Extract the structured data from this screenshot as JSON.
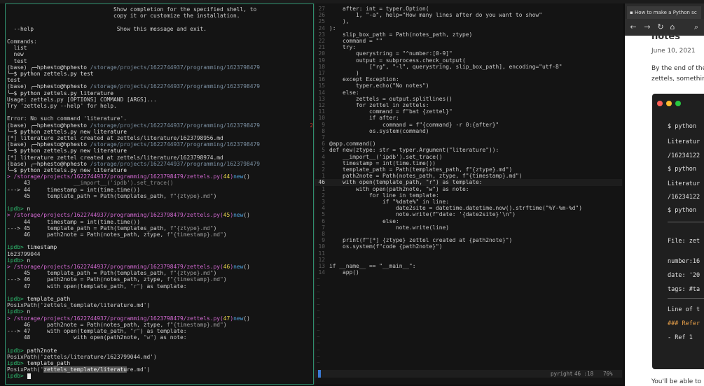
{
  "terminal": {
    "lines": [
      [
        {
          "t": "                                Show completion for the specified shell, to",
          "c": "#cfcfcf"
        }
      ],
      [
        {
          "t": "                                copy it or customize the installation.",
          "c": "#cfcfcf"
        }
      ],
      [
        {
          "t": "",
          "c": "#cfcfcf"
        }
      ],
      [
        {
          "t": "  --help                         Show this message and exit.",
          "c": "#cfcfcf"
        }
      ],
      [
        {
          "t": "",
          "c": "#cfcfcf"
        }
      ],
      [
        {
          "t": "Commands:",
          "c": "#cfcfcf"
        }
      ],
      [
        {
          "t": "  list",
          "c": "#cfcfcf"
        }
      ],
      [
        {
          "t": "  new",
          "c": "#cfcfcf"
        }
      ],
      [
        {
          "t": "  test",
          "c": "#cfcfcf"
        }
      ],
      [
        {
          "t": "(base) ",
          "c": "#cfcfcf"
        },
        {
          "t": "╭─hphesto@hphesto ",
          "c": "#e0e0e0"
        },
        {
          "t": "/storage/projects/1622744937/programming/1623798479",
          "c": "#7a8ea0"
        }
      ],
      [
        {
          "t": "╰─$ python zettels.py test",
          "c": "#e0e0e0"
        }
      ],
      [
        {
          "t": "test",
          "c": "#cfcfcf"
        }
      ],
      [
        {
          "t": "(base) ",
          "c": "#cfcfcf"
        },
        {
          "t": "╭─hphesto@hphesto ",
          "c": "#e0e0e0"
        },
        {
          "t": "/storage/projects/1622744937/programming/1623798479",
          "c": "#7a8ea0"
        }
      ],
      [
        {
          "t": "╰─$ python zettels.py literature",
          "c": "#e0e0e0"
        }
      ],
      [
        {
          "t": "Usage: zettels.py [OPTIONS] COMMAND [ARGS]...",
          "c": "#cfcfcf"
        }
      ],
      [
        {
          "t": "Try 'zettels.py --help' for help.",
          "c": "#cfcfcf"
        }
      ],
      [
        {
          "t": "",
          "c": "#cfcfcf"
        }
      ],
      [
        {
          "t": "Error: No such command 'literature'.",
          "c": "#cfcfcf"
        }
      ],
      [
        {
          "t": "(base) ",
          "c": "#cfcfcf"
        },
        {
          "t": "╭─hphesto@hphesto ",
          "c": "#e0e0e0"
        },
        {
          "t": "/storage/projects/1622744937/programming/1623798479",
          "c": "#7a8ea0"
        },
        {
          "t": "               2 ↵",
          "c": "#c0392b"
        }
      ],
      [
        {
          "t": "╰─$ python zettels.py new literature",
          "c": "#e0e0e0"
        }
      ],
      [
        {
          "t": "[*] literature zettel created at zettels/literature/1623798956.md",
          "c": "#cfcfcf"
        }
      ],
      [
        {
          "t": "(base) ",
          "c": "#cfcfcf"
        },
        {
          "t": "╭─hphesto@hphesto ",
          "c": "#e0e0e0"
        },
        {
          "t": "/storage/projects/1622744937/programming/1623798479",
          "c": "#7a8ea0"
        }
      ],
      [
        {
          "t": "╰─$ python zettels.py new literature",
          "c": "#e0e0e0"
        }
      ],
      [
        {
          "t": "[*] literature zettel created at zettels/literature/1623798974.md",
          "c": "#cfcfcf"
        }
      ],
      [
        {
          "t": "(base) ",
          "c": "#cfcfcf"
        },
        {
          "t": "╭─hphesto@hphesto ",
          "c": "#e0e0e0"
        },
        {
          "t": "/storage/projects/1622744937/programming/1623798479",
          "c": "#7a8ea0"
        }
      ],
      [
        {
          "t": "╰─$ python zettels.py new literature",
          "c": "#e0e0e0"
        }
      ],
      [
        {
          "t": "> /storage/projects/1622744937/programming/1623798479/zettels.py(",
          "c": "#d46ad4"
        },
        {
          "t": "44",
          "c": "#e8d44d"
        },
        {
          "t": ")",
          "c": "#d46ad4"
        },
        {
          "t": "new",
          "c": "#4fa3e0"
        },
        {
          "t": "()",
          "c": "#cfcfcf"
        }
      ],
      [
        {
          "t": "     43             ",
          "c": "#cfcfcf"
        },
        {
          "t": "__import__('ipdb').set_trace()",
          "c": "#8a8a8a"
        }
      ],
      [
        {
          "t": "---> 44     ",
          "c": "#cfcfcf"
        },
        {
          "t": "timestamp = int(time.time())",
          "c": "#cfcfcf"
        }
      ],
      [
        {
          "t": "     45     ",
          "c": "#cfcfcf"
        },
        {
          "t": "template_path = Path(templates_path, ",
          "c": "#cfcfcf"
        },
        {
          "t": "f\"{ztype}.md\"",
          "c": "#9a9a9a"
        },
        {
          "t": ")",
          "c": "#cfcfcf"
        }
      ],
      [
        {
          "t": "",
          "c": "#cfcfcf"
        }
      ],
      [
        {
          "t": "ipdb> ",
          "c": "#2fbf71"
        },
        {
          "t": "n",
          "c": "#e0e0e0"
        }
      ],
      [
        {
          "t": "> /storage/projects/1622744937/programming/1623798479/zettels.py(",
          "c": "#d46ad4"
        },
        {
          "t": "45",
          "c": "#e8d44d"
        },
        {
          "t": ")",
          "c": "#d46ad4"
        },
        {
          "t": "new",
          "c": "#4fa3e0"
        },
        {
          "t": "()",
          "c": "#cfcfcf"
        }
      ],
      [
        {
          "t": "     44     ",
          "c": "#cfcfcf"
        },
        {
          "t": "timestamp = int(time.time())",
          "c": "#cfcfcf"
        }
      ],
      [
        {
          "t": "---> 45     ",
          "c": "#cfcfcf"
        },
        {
          "t": "template_path = Path(templates_path, ",
          "c": "#cfcfcf"
        },
        {
          "t": "f\"{ztype}.md\"",
          "c": "#9a9a9a"
        },
        {
          "t": ")",
          "c": "#cfcfcf"
        }
      ],
      [
        {
          "t": "     46     ",
          "c": "#cfcfcf"
        },
        {
          "t": "path2note = Path(notes_path, ztype, ",
          "c": "#cfcfcf"
        },
        {
          "t": "f\"{timestamp}.md\"",
          "c": "#9a9a9a"
        },
        {
          "t": ")",
          "c": "#cfcfcf"
        }
      ],
      [
        {
          "t": "",
          "c": "#cfcfcf"
        }
      ],
      [
        {
          "t": "ipdb> ",
          "c": "#2fbf71"
        },
        {
          "t": "timestamp",
          "c": "#e0e0e0"
        }
      ],
      [
        {
          "t": "1623799044",
          "c": "#cfcfcf"
        }
      ],
      [
        {
          "t": "ipdb> ",
          "c": "#2fbf71"
        },
        {
          "t": "n",
          "c": "#e0e0e0"
        }
      ],
      [
        {
          "t": "> /storage/projects/1622744937/programming/1623798479/zettels.py(",
          "c": "#d46ad4"
        },
        {
          "t": "46",
          "c": "#e8d44d"
        },
        {
          "t": ")",
          "c": "#d46ad4"
        },
        {
          "t": "new",
          "c": "#4fa3e0"
        },
        {
          "t": "()",
          "c": "#cfcfcf"
        }
      ],
      [
        {
          "t": "     45     ",
          "c": "#cfcfcf"
        },
        {
          "t": "template_path = Path(templates_path, ",
          "c": "#cfcfcf"
        },
        {
          "t": "f\"{ztype}.md\"",
          "c": "#9a9a9a"
        },
        {
          "t": ")",
          "c": "#cfcfcf"
        }
      ],
      [
        {
          "t": "---> 46     ",
          "c": "#cfcfcf"
        },
        {
          "t": "path2note = Path(notes_path, ztype, ",
          "c": "#cfcfcf"
        },
        {
          "t": "f\"{timestamp}.md\"",
          "c": "#9a9a9a"
        },
        {
          "t": ")",
          "c": "#cfcfcf"
        }
      ],
      [
        {
          "t": "     47     ",
          "c": "#cfcfcf"
        },
        {
          "t": "with open(template_path, ",
          "c": "#cfcfcf"
        },
        {
          "t": "\"r\"",
          "c": "#9a9a9a"
        },
        {
          "t": ") as template:",
          "c": "#cfcfcf"
        }
      ],
      [
        {
          "t": "",
          "c": "#cfcfcf"
        }
      ],
      [
        {
          "t": "ipdb> ",
          "c": "#2fbf71"
        },
        {
          "t": "template_path",
          "c": "#e0e0e0"
        }
      ],
      [
        {
          "t": "PosixPath('zettels_template/literature.md')",
          "c": "#cfcfcf"
        }
      ],
      [
        {
          "t": "ipdb> ",
          "c": "#2fbf71"
        },
        {
          "t": "n",
          "c": "#e0e0e0"
        }
      ],
      [
        {
          "t": "> /storage/projects/1622744937/programming/1623798479/zettels.py(",
          "c": "#d46ad4"
        },
        {
          "t": "47",
          "c": "#e8d44d"
        },
        {
          "t": ")",
          "c": "#d46ad4"
        },
        {
          "t": "new",
          "c": "#4fa3e0"
        },
        {
          "t": "()",
          "c": "#cfcfcf"
        }
      ],
      [
        {
          "t": "     46     ",
          "c": "#cfcfcf"
        },
        {
          "t": "path2note = Path(notes_path, ztype, ",
          "c": "#cfcfcf"
        },
        {
          "t": "f\"{timestamp}.md\"",
          "c": "#9a9a9a"
        },
        {
          "t": ")",
          "c": "#cfcfcf"
        }
      ],
      [
        {
          "t": "---> 47     ",
          "c": "#cfcfcf"
        },
        {
          "t": "with open(template_path, ",
          "c": "#cfcfcf"
        },
        {
          "t": "\"r\"",
          "c": "#9a9a9a"
        },
        {
          "t": ") as template:",
          "c": "#cfcfcf"
        }
      ],
      [
        {
          "t": "     48             ",
          "c": "#cfcfcf"
        },
        {
          "t": "with open(path2note, ",
          "c": "#cfcfcf"
        },
        {
          "t": "\"w\"",
          "c": "#9a9a9a"
        },
        {
          "t": ") as note:",
          "c": "#cfcfcf"
        }
      ],
      [
        {
          "t": "",
          "c": "#cfcfcf"
        }
      ],
      [
        {
          "t": "ipdb> ",
          "c": "#2fbf71"
        },
        {
          "t": "path2note",
          "c": "#e0e0e0"
        }
      ],
      [
        {
          "t": "PosixPath('zettels/literature/1623799044.md')",
          "c": "#cfcfcf"
        }
      ],
      [
        {
          "t": "ipdb> ",
          "c": "#2fbf71"
        },
        {
          "t": "template_path",
          "c": "#e0e0e0"
        }
      ],
      [
        {
          "t": "PosixPath('",
          "c": "#cfcfcf"
        },
        {
          "t": "zettels_template/literatu",
          "c": "#eeeeee",
          "sel": true
        },
        {
          "t": "re.md')",
          "c": "#cfcfcf"
        }
      ],
      [
        {
          "t": "ipdb> ",
          "c": "#2fbf71"
        },
        {
          "t": "",
          "c": "#e0e0e0",
          "cursor": true
        }
      ]
    ]
  },
  "editor": {
    "lines": [
      {
        "n": "27",
        "parts": [
          {
            "t": "    after: int = typer.Option(",
            "c": "#c9c9c9"
          }
        ]
      },
      {
        "n": "26",
        "parts": [
          {
            "t": "        1, \"-a\", help=\"How many lines after do you want to show\"",
            "c": "#c9c9c9"
          }
        ]
      },
      {
        "n": "25",
        "parts": [
          {
            "t": "    ),",
            "c": "#c9c9c9"
          }
        ]
      },
      {
        "n": "24",
        "parts": [
          {
            "t": "):",
            "c": "#c9c9c9"
          }
        ]
      },
      {
        "n": "23",
        "parts": [
          {
            "t": "    slip_box_path = Path(notes_path, ztype)",
            "c": "#c9c9c9"
          }
        ]
      },
      {
        "n": "22",
        "parts": [
          {
            "t": "    command = \"\"",
            "c": "#c9c9c9"
          }
        ]
      },
      {
        "n": "21",
        "parts": [
          {
            "t": "    try:",
            "c": "#c9c9c9"
          }
        ]
      },
      {
        "n": "20",
        "parts": [
          {
            "t": "        querystring = \"^number:[0-9]\"",
            "c": "#c9c9c9"
          }
        ]
      },
      {
        "n": "19",
        "parts": [
          {
            "t": "        output = subprocess.check_output(",
            "c": "#c9c9c9"
          }
        ]
      },
      {
        "n": "18",
        "parts": [
          {
            "t": "            [\"rg\", \"-l\", querystring, slip_box_path], encoding=\"utf-8\"",
            "c": "#c9c9c9"
          }
        ]
      },
      {
        "n": "17",
        "parts": [
          {
            "t": "        )",
            "c": "#c9c9c9"
          }
        ]
      },
      {
        "n": "16",
        "parts": [
          {
            "t": "    except Exception:",
            "c": "#c9c9c9"
          }
        ]
      },
      {
        "n": "15",
        "parts": [
          {
            "t": "        typer.echo(\"No notes\")",
            "c": "#c9c9c9"
          }
        ]
      },
      {
        "n": "14",
        "parts": [
          {
            "t": "    else:",
            "c": "#c9c9c9"
          }
        ]
      },
      {
        "n": "13",
        "parts": [
          {
            "t": "        zettels = output.splitlines()",
            "c": "#c9c9c9"
          }
        ]
      },
      {
        "n": "12",
        "parts": [
          {
            "t": "        for zettel in zettels:",
            "c": "#c9c9c9"
          }
        ]
      },
      {
        "n": "11",
        "parts": [
          {
            "t": "            command = f\"bat {zettel}\"",
            "c": "#c9c9c9"
          }
        ]
      },
      {
        "n": "10",
        "parts": [
          {
            "t": "            if after:",
            "c": "#c9c9c9"
          }
        ]
      },
      {
        "n": "9",
        "parts": [
          {
            "t": "                command = f\"{command} -r 0:{after}\"",
            "c": "#c9c9c9"
          }
        ]
      },
      {
        "n": "8",
        "parts": [
          {
            "t": "            os.system(command)",
            "c": "#c9c9c9"
          }
        ]
      },
      {
        "n": "7",
        "parts": [
          {
            "t": "",
            "c": "#c9c9c9"
          }
        ]
      },
      {
        "n": "6",
        "parts": [
          {
            "t": "@app.command()",
            "c": "#c9c9c9"
          }
        ]
      },
      {
        "n": "5",
        "parts": [
          {
            "t": "def new(ztype: str = typer.Argument(\"literature\")):",
            "c": "#c9c9c9"
          }
        ]
      },
      {
        "n": "4",
        "parts": [
          {
            "t": "    __import__('ipdb').set_trace()",
            "c": "#c9c9c9"
          }
        ]
      },
      {
        "n": "3",
        "parts": [
          {
            "t": "    timestamp = int(time.time())",
            "c": "#c9c9c9"
          }
        ]
      },
      {
        "n": "2",
        "parts": [
          {
            "t": "    template_path = Path(templates_path, f\"{ztype}.md\")",
            "c": "#c9c9c9"
          }
        ]
      },
      {
        "n": "1",
        "parts": [
          {
            "t": "    path2note = Path(notes_path, ztype, f\"{timestamp}.md\")",
            "c": "#c9c9c9"
          }
        ]
      },
      {
        "n": "46",
        "parts": [
          {
            "t": "    with open(template_path, \"r\") as template:",
            "c": "#c9c9c9"
          }
        ]
      },
      {
        "n": "1",
        "parts": [
          {
            "t": "        with open(path2note, \"w\") as note:",
            "c": "#c9c9c9"
          }
        ]
      },
      {
        "n": "2",
        "parts": [
          {
            "t": "            for line in template:",
            "c": "#c9c9c9"
          }
        ]
      },
      {
        "n": "3",
        "parts": [
          {
            "t": "                if \"%date%\" in line:",
            "c": "#c9c9c9"
          }
        ]
      },
      {
        "n": "4",
        "parts": [
          {
            "t": "                    date2site = datetime.datetime.now().strftime(\"%Y-%m-%d\")",
            "c": "#c9c9c9"
          }
        ]
      },
      {
        "n": "5",
        "parts": [
          {
            "t": "                    note.write(f\"date: '{date2site}'\\n\")",
            "c": "#c9c9c9"
          }
        ]
      },
      {
        "n": "6",
        "parts": [
          {
            "t": "                else:",
            "c": "#c9c9c9"
          }
        ]
      },
      {
        "n": "7",
        "parts": [
          {
            "t": "                    note.write(line)",
            "c": "#c9c9c9"
          }
        ]
      },
      {
        "n": "8",
        "parts": [
          {
            "t": "",
            "c": "#c9c9c9"
          }
        ]
      },
      {
        "n": "9",
        "parts": [
          {
            "t": "    print(f\"[*] {ztype} zettel created at {path2note}\")",
            "c": "#c9c9c9"
          }
        ]
      },
      {
        "n": "10",
        "parts": [
          {
            "t": "    os.system(f\"code {path2note}\")",
            "c": "#c9c9c9"
          }
        ]
      },
      {
        "n": "11",
        "parts": [
          {
            "t": "",
            "c": "#c9c9c9"
          }
        ]
      },
      {
        "n": "12",
        "parts": [
          {
            "t": "",
            "c": "#c9c9c9"
          }
        ]
      },
      {
        "n": "13",
        "parts": [
          {
            "t": "if __name__ == \"__main__\":",
            "c": "#c9c9c9"
          }
        ]
      },
      {
        "n": "14",
        "parts": [
          {
            "t": "    app()",
            "c": "#c9c9c9"
          }
        ]
      }
    ],
    "tilde": "~",
    "tilde_count": 14,
    "status": {
      "lsp": "pyright",
      "position": "46 :18",
      "percent": "76%"
    }
  },
  "browser": {
    "tab_title": "How to make a Python sc",
    "nav": {
      "back": "←",
      "forward": "→",
      "reload": "↻",
      "home": "⌂",
      "search": "⌕"
    },
    "page": {
      "heading_partial": "notes",
      "date": "June 10, 2021",
      "intro1": "By the end of the",
      "intro2": "zettels, somethin",
      "footer": "You'll be able to",
      "code_lines": [
        "$ python",
        "Literatur",
        "/16234122",
        "$ python",
        "Literatur",
        "/16234122",
        "$ python",
        "",
        "File: zet",
        "",
        "number:16",
        "date: '20",
        "tags: #ta",
        "",
        "Line of t",
        "### Refer",
        "- Ref 1"
      ]
    },
    "colors": {
      "red": "#ff5f57",
      "yellow": "#febc2e",
      "green": "#28c840",
      "heading": "#e8a04a"
    }
  }
}
